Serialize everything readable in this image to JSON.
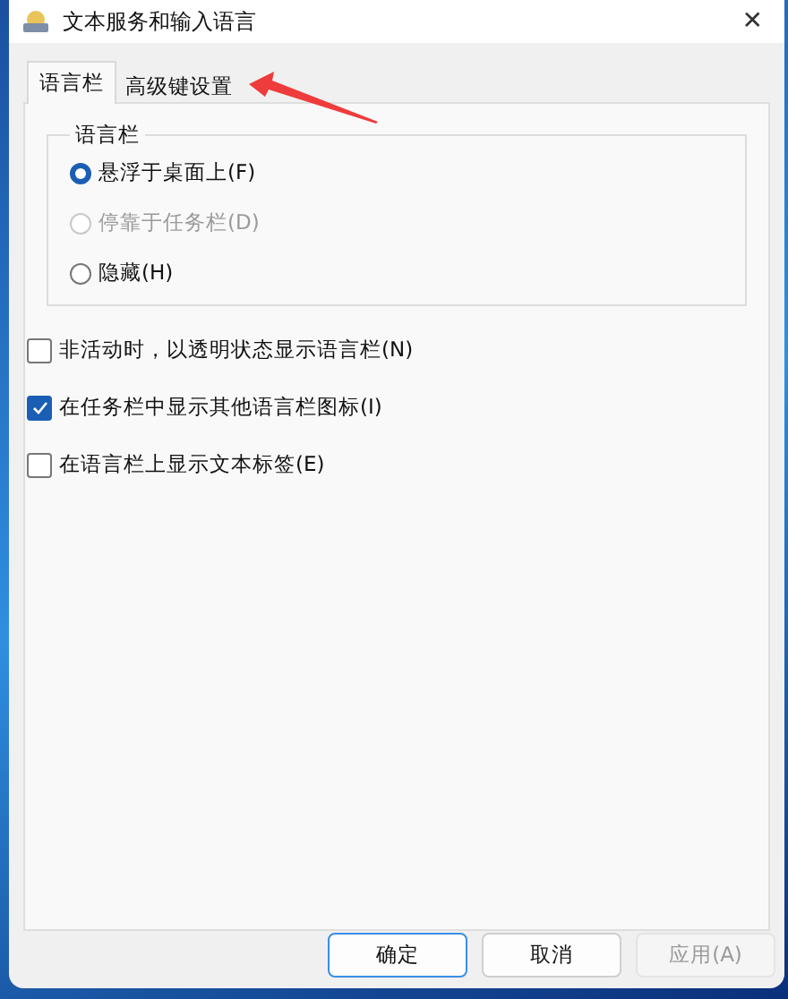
{
  "window": {
    "title": "文本服务和输入语言",
    "close": "✕"
  },
  "tabs": [
    {
      "label": "语言栏",
      "selected": true
    },
    {
      "label": "高级键设置",
      "selected": false
    }
  ],
  "group": {
    "label": "语言栏",
    "options": [
      {
        "label": "悬浮于桌面上(F)",
        "selected": true,
        "disabled": false
      },
      {
        "label": "停靠于任务栏(D)",
        "selected": false,
        "disabled": true
      },
      {
        "label": "隐藏(H)",
        "selected": false,
        "disabled": false
      }
    ]
  },
  "checkboxes": [
    {
      "label": "非活动时，以透明状态显示语言栏(N)",
      "checked": false
    },
    {
      "label": "在任务栏中显示其他语言栏图标(I)",
      "checked": true
    },
    {
      "label": "在语言栏上显示文本标签(E)",
      "checked": false
    }
  ],
  "buttons": [
    {
      "label": "确定",
      "default": true,
      "disabled": false
    },
    {
      "label": "取消",
      "default": false,
      "disabled": false
    },
    {
      "label": "应用(A)",
      "default": false,
      "disabled": true
    }
  ]
}
